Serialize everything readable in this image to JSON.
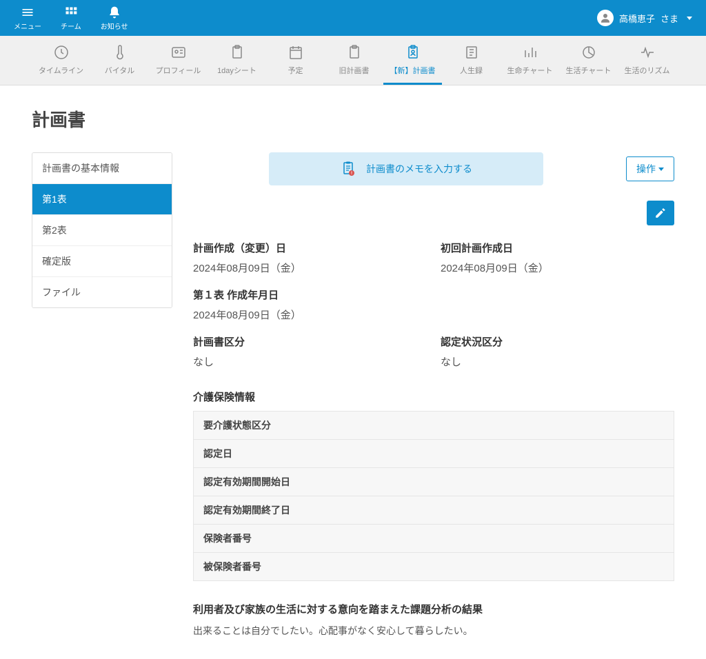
{
  "header": {
    "menu": "メニュー",
    "team": "チーム",
    "notifications": "お知らせ",
    "user_name": "高橋恵子",
    "user_suffix": "さま"
  },
  "subnav": {
    "timeline": "タイムライン",
    "vital": "バイタル",
    "profile": "プロフィール",
    "oneday": "1dayシート",
    "schedule": "予定",
    "old_plan": "旧計画書",
    "new_plan": "【新】計画書",
    "life_record": "人生録",
    "life_chart": "生命チャート",
    "living_chart": "生活チャート",
    "rhythm": "生活のリズム"
  },
  "page_title": "計画書",
  "side_tabs": {
    "basic": "計画書の基本情報",
    "table1": "第1表",
    "table2": "第2表",
    "confirmed": "確定版",
    "file": "ファイル"
  },
  "memo_banner": "計画書のメモを入力する",
  "action_button": "操作",
  "fields": {
    "plan_date_label": "計画作成（変更）日",
    "plan_date_value": "2024年08月09日（金）",
    "first_plan_label": "初回計画作成日",
    "first_plan_value": "2024年08月09日（金）",
    "table1_date_label": "第１表 作成年月日",
    "table1_date_value": "2024年08月09日（金）",
    "plan_category_label": "計画書区分",
    "plan_category_value": "なし",
    "cert_status_label": "認定状況区分",
    "cert_status_value": "なし"
  },
  "insurance": {
    "title": "介護保険情報",
    "rows": [
      "要介護状態区分",
      "認定日",
      "認定有効期間開始日",
      "認定有効期間終了日",
      "保険者番号",
      "被保険者番号"
    ]
  },
  "analysis": {
    "title": "利用者及び家族の生活に対する意向を踏まえた課題分析の結果",
    "text": "出来ることは自分でしたい。心配事がなく安心して暮らしたい。"
  }
}
